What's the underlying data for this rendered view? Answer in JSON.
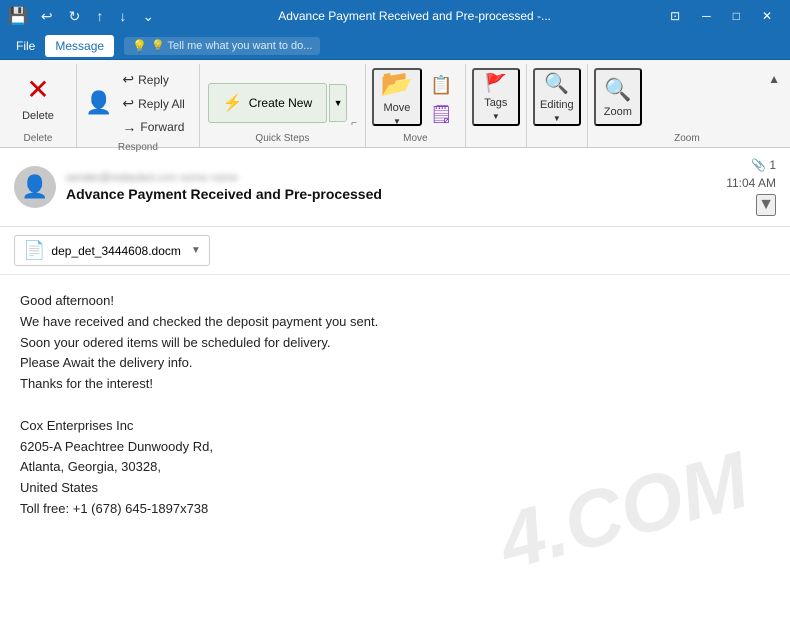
{
  "titleBar": {
    "title": "Advance Payment Received and Pre-processed -...",
    "saveIcon": "💾",
    "undoIcon": "↩",
    "redoIcon": "↻",
    "upIcon": "↑",
    "downIcon": "↓",
    "moreIcon": "⌄",
    "minimizeIcon": "─",
    "restoreIcon": "□",
    "closeIcon": "✕",
    "windowIcon": "⊡"
  },
  "menuBar": {
    "items": [
      {
        "label": "File",
        "active": false
      },
      {
        "label": "Message",
        "active": true
      }
    ],
    "tellMe": "💡 Tell me what you want to do..."
  },
  "ribbon": {
    "groups": [
      {
        "name": "delete",
        "label": "Delete",
        "buttons": [
          {
            "icon": "✕",
            "label": "Delete"
          }
        ]
      },
      {
        "name": "respond",
        "label": "Respond",
        "items": [
          {
            "icon": "↩",
            "label": "Reply"
          },
          {
            "icon": "↩↩",
            "label": "Reply All"
          },
          {
            "icon": "→",
            "label": "Forward"
          }
        ]
      },
      {
        "name": "quickSteps",
        "label": "Quick Steps",
        "createNew": "Create New",
        "createNewIcon": "⚡"
      },
      {
        "name": "move",
        "label": "Move",
        "buttons": [
          {
            "icon": "📂",
            "label": "Move"
          },
          {
            "icon": "📋",
            "label": ""
          }
        ]
      },
      {
        "name": "tags",
        "label": "",
        "buttons": [
          {
            "icon": "🏷",
            "label": "Tags"
          }
        ]
      },
      {
        "name": "editing",
        "label": "",
        "buttons": [
          {
            "icon": "🔍",
            "label": "Editing"
          }
        ]
      },
      {
        "name": "zoom",
        "label": "Zoom",
        "buttons": [
          {
            "icon": "🔍",
            "label": "Zoom"
          }
        ]
      }
    ]
  },
  "email": {
    "from": "sender@example.com   some name",
    "subject": "Advance Payment Received and Pre-processed",
    "time": "11:04 AM",
    "attachmentCount": "1",
    "attachmentName": "dep_det_3444608.docm",
    "body": {
      "greeting": "Good afternoon!",
      "line1": "We have received and checked the deposit payment you sent.",
      "line2": "Soon your odered items will be scheduled for delivery.",
      "line3": "Please Await the delivery info.",
      "line4": "Thanks for the interest!",
      "company": "Cox Enterprises Inc",
      "address1": "6205-A Peachtree Dunwoody Rd,",
      "address2": "Atlanta, Georgia, 30328,",
      "address3": "United States",
      "phone": "Toll free: +1 (678) 645-1897x738"
    },
    "watermark": "4.COM"
  }
}
